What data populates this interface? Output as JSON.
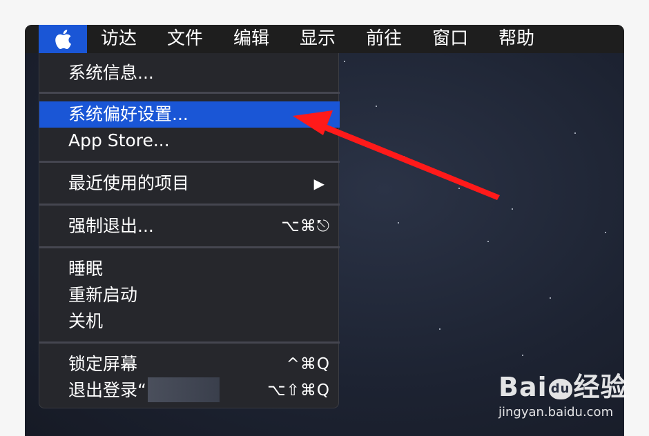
{
  "menubar": {
    "apple_icon": "apple-logo-icon",
    "items": [
      "访达",
      "文件",
      "编辑",
      "显示",
      "前往",
      "窗口",
      "帮助"
    ]
  },
  "apple_menu": {
    "items": [
      {
        "label": "系统信息...",
        "shortcut": ""
      },
      {
        "label": "系统偏好设置...",
        "shortcut": "",
        "highlighted": true
      },
      {
        "label": "App Store...",
        "shortcut": ""
      },
      {
        "label": "最近使用的项目",
        "shortcut": "",
        "submenu": true,
        "arrow": "▶"
      },
      {
        "label": "强制退出...",
        "shortcut": "⌥⌘⎋"
      },
      {
        "label": "睡眠",
        "shortcut": ""
      },
      {
        "label": "重新启动",
        "shortcut": ""
      },
      {
        "label": "关机",
        "shortcut": ""
      },
      {
        "label": "锁定屏幕",
        "shortcut": "^⌘Q"
      },
      {
        "label": "退出登录“",
        "shortcut": "⌥⇧⌘Q"
      }
    ]
  },
  "annotation": {
    "arrow_color": "#ff1a1a"
  },
  "watermark": {
    "brand": "Bai",
    "paw": "du",
    "cn": "经验",
    "url": "jingyan.baidu.com"
  },
  "colors": {
    "highlight": "#1a56d6",
    "menu_bg": "#26272c"
  }
}
